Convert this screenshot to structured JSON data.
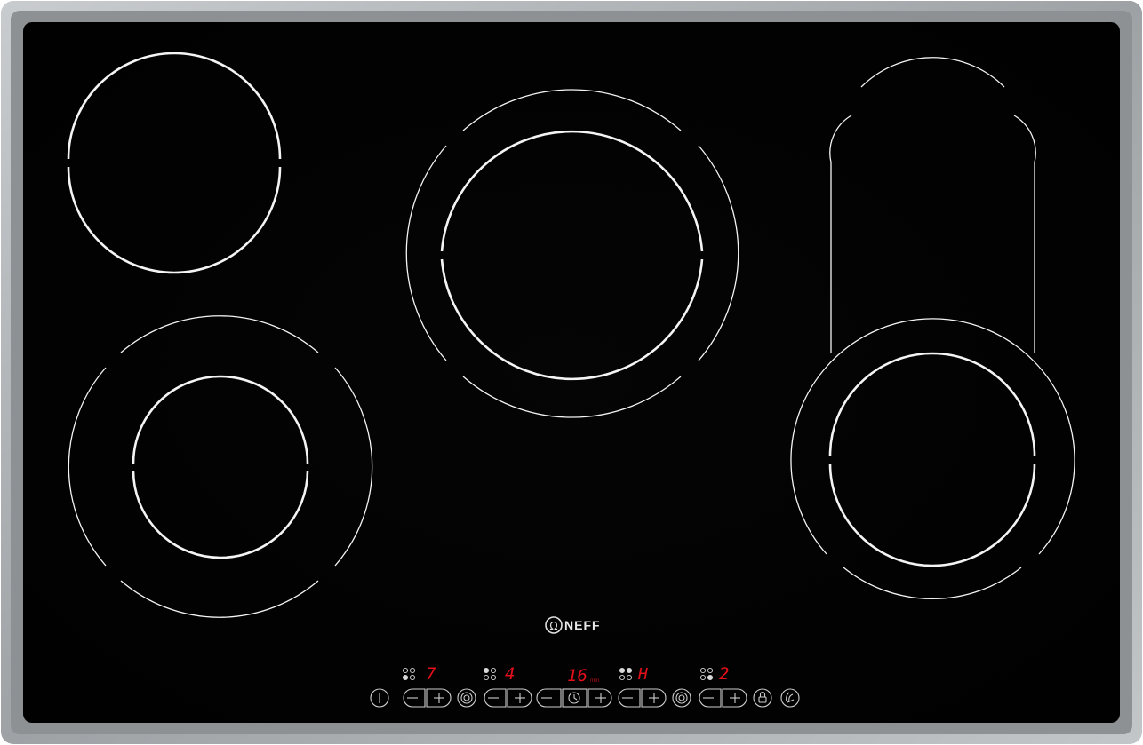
{
  "brand": {
    "name": "NEFF"
  },
  "colors": {
    "glass": "#020202",
    "frame": "#a8abad",
    "display_red": "#e3101a",
    "ring_white": "#f4f4f4"
  },
  "zones": [
    {
      "id": "front-left",
      "setting": "7"
    },
    {
      "id": "rear-left",
      "setting": "4"
    },
    {
      "id": "centre",
      "setting": "H"
    },
    {
      "id": "right",
      "setting": "2"
    }
  ],
  "timer": {
    "value": "16",
    "unit": "min"
  },
  "controls": {
    "power_icon": "power-icon",
    "minus_icon": "minus-icon",
    "plus_icon": "plus-icon",
    "dual_ring_icon": "dual-ring-icon",
    "timer_icon": "clock-icon",
    "child_lock_icon": "key-lock-icon",
    "wipe_protect_icon": "hand-icon"
  }
}
